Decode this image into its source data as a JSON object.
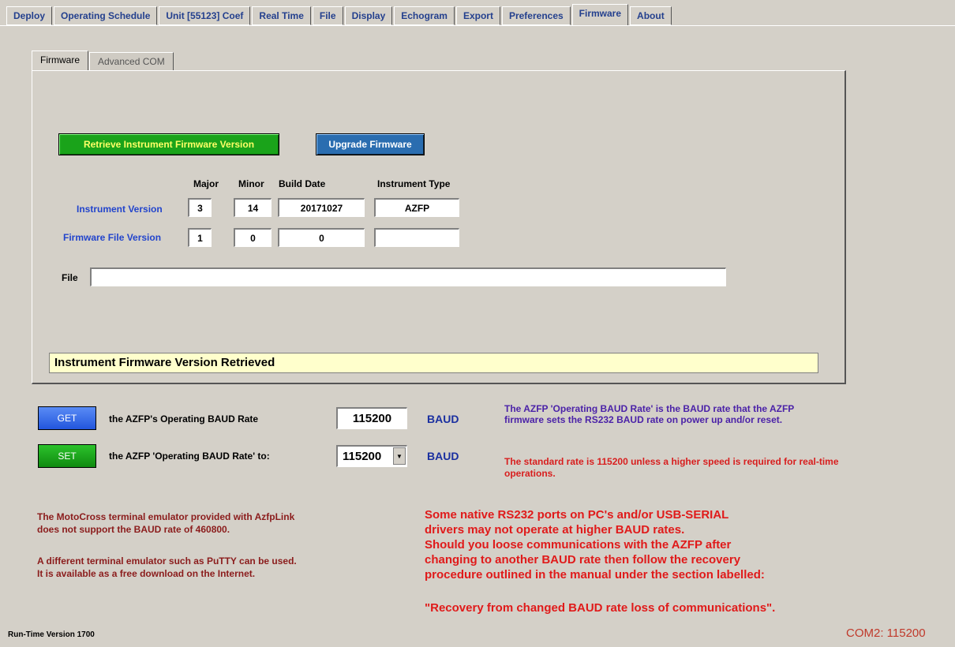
{
  "top_tabs": [
    {
      "label": "Deploy"
    },
    {
      "label": "Operating Schedule"
    },
    {
      "label": "Unit [55123] Coef"
    },
    {
      "label": "Real Time"
    },
    {
      "label": "File"
    },
    {
      "label": "Display"
    },
    {
      "label": "Echogram"
    },
    {
      "label": "Export"
    },
    {
      "label": "Preferences"
    },
    {
      "label": "Firmware",
      "active": true
    },
    {
      "label": "About"
    }
  ],
  "inner_tabs": [
    {
      "label": "Firmware",
      "active": true
    },
    {
      "label": "Advanced COM"
    }
  ],
  "firmware": {
    "retrieve_button": "Retrieve Instrument Firmware Version",
    "upgrade_button": "Upgrade Firmware",
    "headers": {
      "major": "Major",
      "minor": "Minor",
      "build_date": "Build Date",
      "instrument_type": "Instrument Type"
    },
    "instrument_version": {
      "label": "Instrument Version",
      "major": "3",
      "minor": "14",
      "build_date": "20171027",
      "type": "AZFP"
    },
    "firmware_file_version": {
      "label": "Firmware File Version",
      "major": "1",
      "minor": "0",
      "build_date": "0",
      "type": ""
    },
    "file_label": "File",
    "file_value": "",
    "status": "Instrument Firmware Version Retrieved"
  },
  "baud": {
    "get_button": "GET",
    "get_label": "the AZFP's Operating BAUD Rate",
    "get_value": "115200",
    "set_button": "SET",
    "set_label": "the AZFP 'Operating BAUD Rate' to:",
    "set_value": "115200",
    "unit": "BAUD",
    "info_purple": "The AZFP 'Operating BAUD Rate' is the BAUD rate that the AZFP firmware sets the RS232 BAUD rate on power up and/or reset.",
    "info_red": "The standard rate is 115200 unless a higher speed is required for real-time operations."
  },
  "notes": {
    "motocross_1": "The MotoCross terminal emulator provided with AzfpLink",
    "motocross_2": "does not support the BAUD rate of 460800.",
    "putty_1": "A different terminal emulator such as PuTTY can be used.",
    "putty_2": "It is available as a free download on the Internet.",
    "warn_1": "Some native RS232 ports on PC's and/or USB-SERIAL",
    "warn_2": "drivers may not operate at higher BAUD rates.",
    "warn_3": "Should you loose communications with the AZFP after",
    "warn_4": "changing to another BAUD rate then follow the recovery",
    "warn_5": "procedure outlined in the manual under the section labelled:",
    "warn_6": "\"Recovery from changed BAUD rate loss of communications\"."
  },
  "footer": {
    "runtime": "Run-Time Version 1700",
    "com": "COM2: 115200"
  }
}
